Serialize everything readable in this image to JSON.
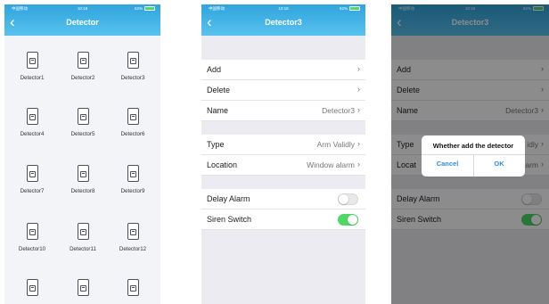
{
  "status": {
    "carrier": "中国移动",
    "time": "10:18",
    "battery": "62%"
  },
  "screen1": {
    "title": "Detector",
    "detectors": [
      "Detector1",
      "Detector2",
      "Detector3",
      "Detector4",
      "Detector5",
      "Detector6",
      "Detector7",
      "Detector8",
      "Detector9",
      "Detector10",
      "Detector11",
      "Detector12",
      "",
      "",
      " ",
      ""
    ]
  },
  "screen2": {
    "title": "Detector3",
    "rows": {
      "add": "Add",
      "delete": "Delete",
      "name": "Name",
      "name_value": "Detector3",
      "type": "Type",
      "type_value": "Arm Validly",
      "location": "Location",
      "location_value": "Window alarm",
      "delay_alarm": "Delay Alarm",
      "siren_switch": "Siren Switch"
    },
    "delay_alarm_on": false,
    "siren_switch_on": true
  },
  "screen3": {
    "title": "Detector3",
    "rows": {
      "add": "Add",
      "delete": "Delete",
      "name": "Name",
      "name_value": "Detector3",
      "type": "Type",
      "type_value": "idly",
      "location": "Locat",
      "location_value": "arm",
      "delay_alarm": "Delay Alarm",
      "siren_switch": "Siren Switch"
    },
    "dialog": {
      "message": "Whether add the detector",
      "cancel": "Cancel",
      "ok": "OK"
    }
  },
  "colors": {
    "header": "#3aaee3",
    "toggle_on": "#4cd964",
    "dialog_button": "#2f8ed8"
  }
}
